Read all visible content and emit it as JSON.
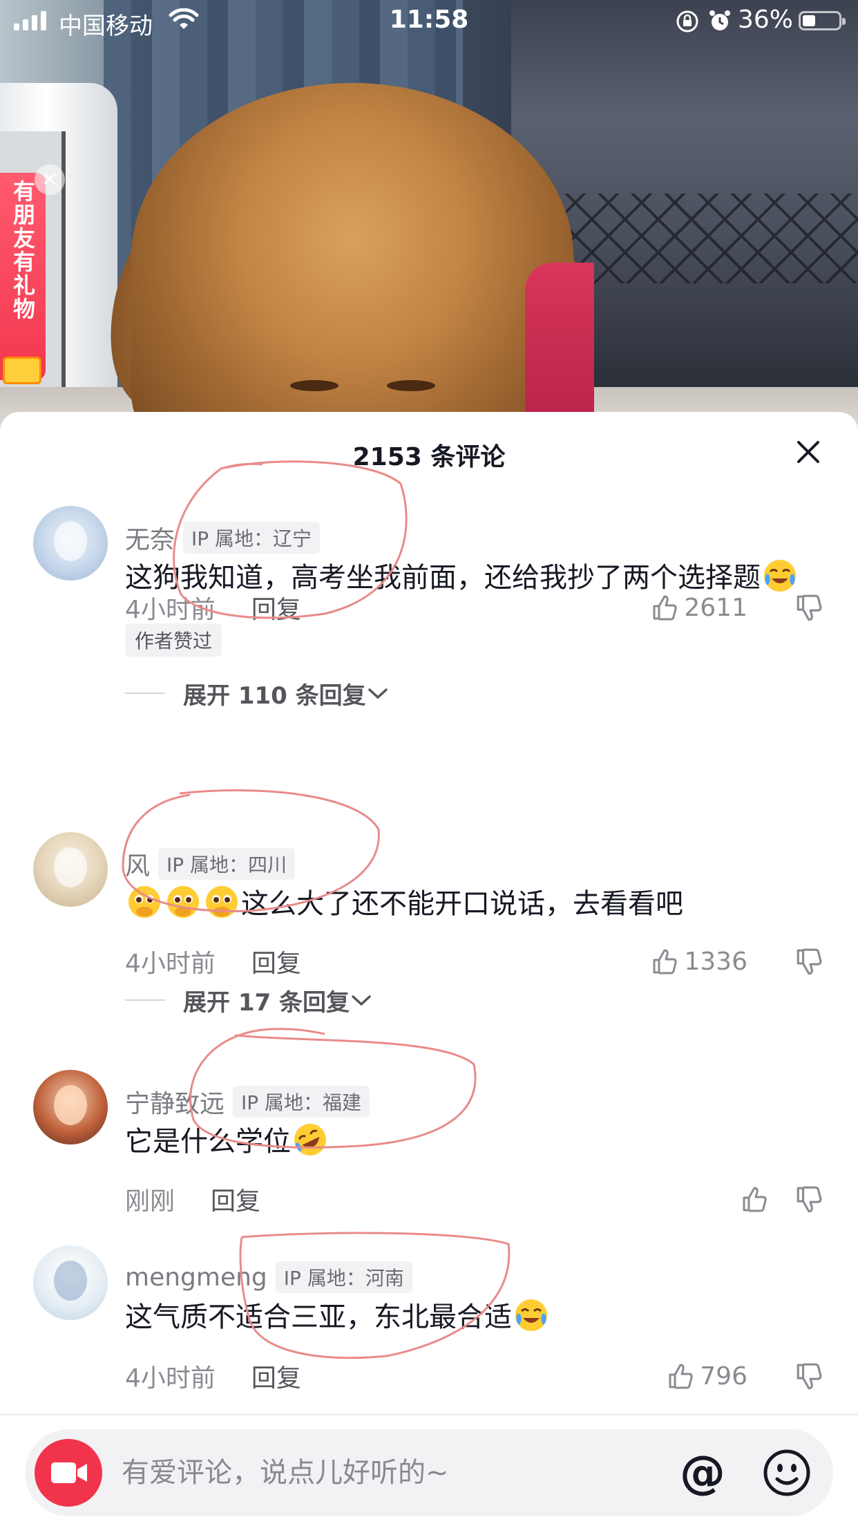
{
  "status_bar": {
    "carrier": "中国移动",
    "time": "11:58",
    "battery": "36%",
    "battery_level": 0.36
  },
  "promo": {
    "text": "有朋友有礼物"
  },
  "sheet": {
    "title": "2153 条评论"
  },
  "comments": [
    {
      "name": "无奈",
      "ip": "IP 属地：辽宁",
      "text": "这狗我知道，高考坐我前面，还给我抄了两个选择题",
      "emojis": [
        "laugh-cry"
      ],
      "time": "4小时前",
      "reply": "回复",
      "likes": "2611",
      "author_liked": "作者赞过",
      "expand": "展开 110 条回复"
    },
    {
      "name": "风",
      "ip": "IP 属地：四川",
      "text": "这么大了还不能开口说话，去看看吧",
      "emojis": [
        "pleading-cover-mouth",
        "pleading-cover-mouth",
        "pleading-cover-mouth"
      ],
      "time": "4小时前",
      "reply": "回复",
      "likes": "1336",
      "expand": "展开 17 条回复"
    },
    {
      "name": "宁静致远",
      "ip": "IP 属地：福建",
      "text": "它是什么学位",
      "emojis": [
        "rolling-laugh"
      ],
      "time": "刚刚",
      "reply": "回复",
      "likes": ""
    },
    {
      "name": "mengmeng",
      "ip": "IP 属地：河南",
      "text": "这气质不适合三亚，东北最合适",
      "emojis": [
        "laugh-cry"
      ],
      "time": "4小时前",
      "reply": "回复",
      "likes": "796"
    }
  ],
  "input": {
    "placeholder": "有爱评论，说点儿好听的~",
    "at_symbol": "@"
  },
  "colors": {
    "accent_red": "#f2334c",
    "annotation_pen": "#e98a8a",
    "text_primary": "#161823",
    "text_secondary": "#8a8b91"
  }
}
